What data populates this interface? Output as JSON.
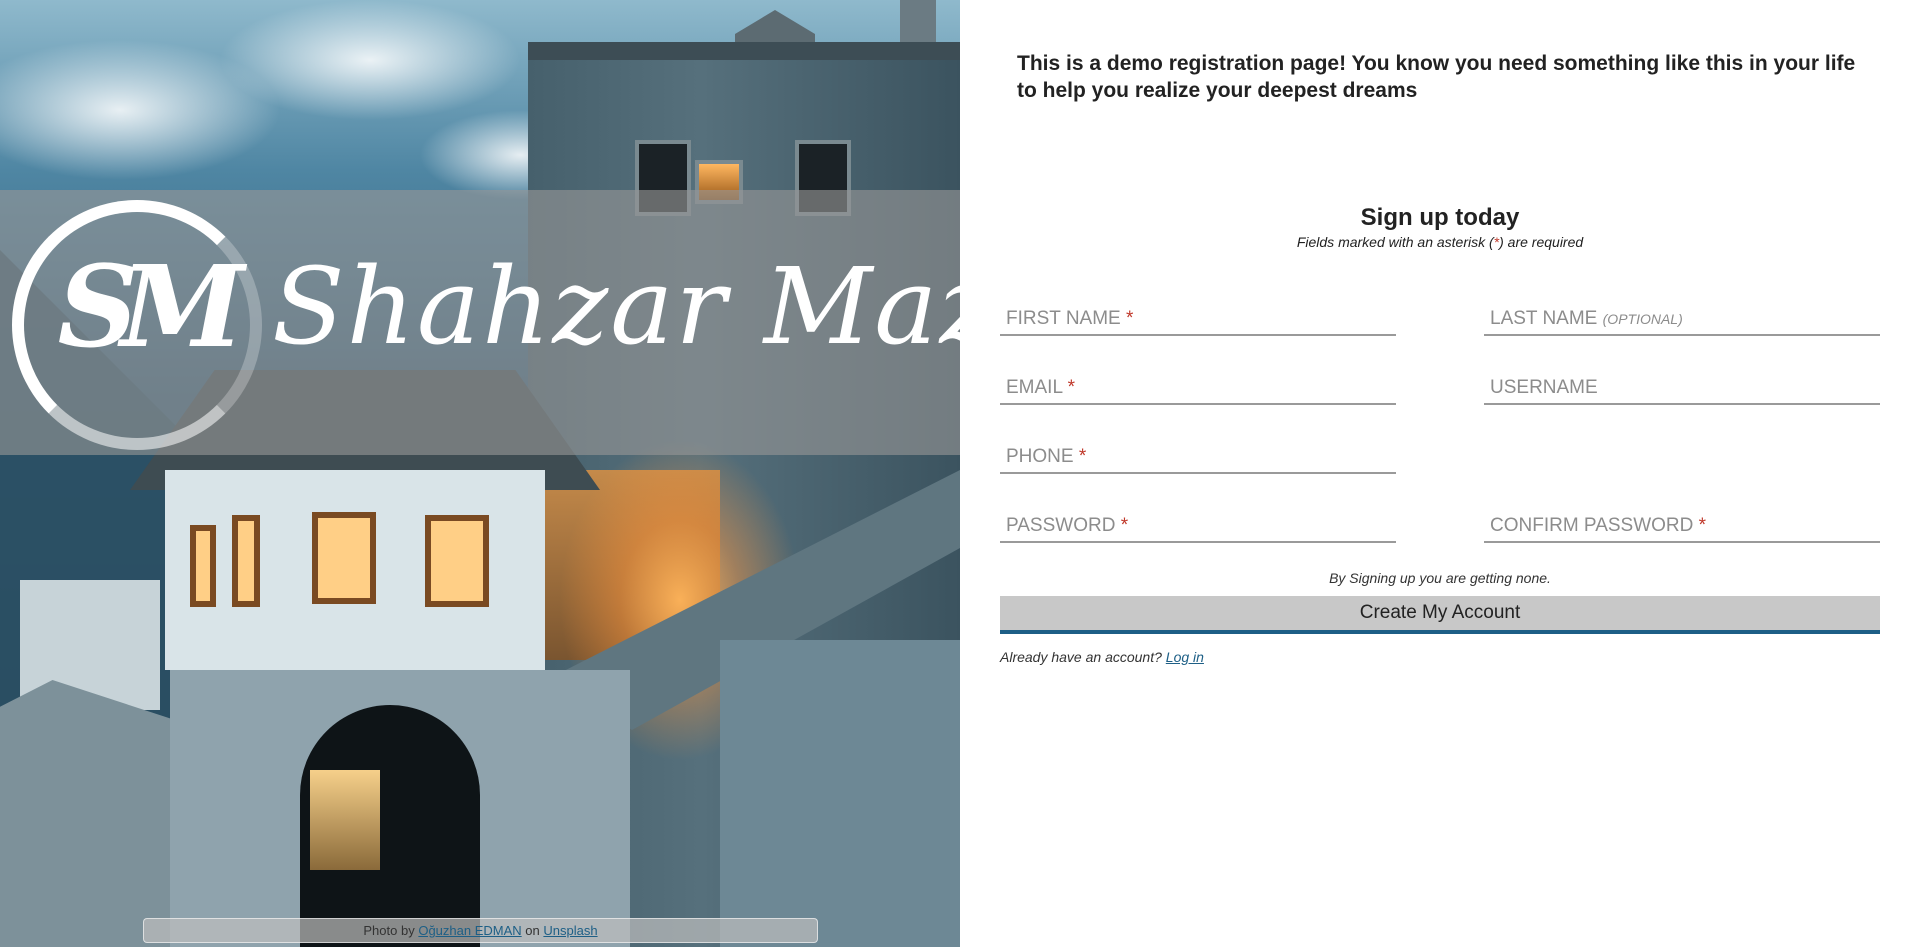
{
  "brand": {
    "monogram": "SM",
    "name": "Shahzar Mazhar"
  },
  "photo_credit": {
    "prefix": "Photo by",
    "author": "Oğuzhan EDMAN",
    "connector": "on",
    "source": "Unsplash"
  },
  "intro_text": "This is a demo registration page! You know you need something like this in your life to help you realize your deepest dreams",
  "signup": {
    "title": "Sign up today",
    "subtitle_prefix": "Fields marked with an asterisk (",
    "asterisk": "*",
    "subtitle_suffix": ") are required"
  },
  "fields": {
    "first_name": {
      "label": "FIRST NAME",
      "marker": "*"
    },
    "last_name": {
      "label": "LAST NAME",
      "marker": "(OPTIONAL)"
    },
    "email": {
      "label": "EMAIL",
      "marker": "*"
    },
    "username": {
      "label": "USERNAME",
      "marker": ""
    },
    "phone": {
      "label": "PHONE",
      "marker": "*"
    },
    "password": {
      "label": "PASSWORD",
      "marker": "*"
    },
    "confirm_password": {
      "label": "CONFIRM PASSWORD",
      "marker": "*"
    }
  },
  "terms_text": "By Signing up you are getting none.",
  "create_button": "Create My Account",
  "login": {
    "prompt": "Already have an account?",
    "link": "Log in"
  },
  "colors": {
    "required_marker": "#c0392b",
    "accent": "#1d5f86",
    "button_bg": "#c8c8c8"
  }
}
